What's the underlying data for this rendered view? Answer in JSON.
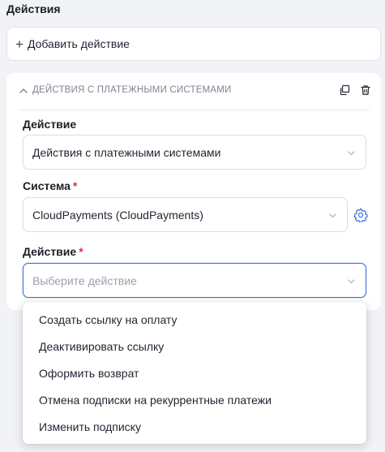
{
  "section": {
    "title": "Действия"
  },
  "add_action": {
    "plus": "+",
    "label": "Добавить действие"
  },
  "panel": {
    "title": "ДЕЙСТВИЯ С ПЛАТЕЖНЫМИ СИСТЕМАМИ",
    "icons": [
      "chevron-up-icon",
      "copy-icon",
      "trash-icon"
    ]
  },
  "fields": {
    "action_type": {
      "label": "Действие",
      "value": "Действия с платежными системами"
    },
    "system": {
      "label": "Система",
      "required_mark": "*",
      "value": "CloudPayments (CloudPayments)"
    },
    "action": {
      "label": "Действие",
      "required_mark": "*",
      "placeholder": "Выберите действие"
    }
  },
  "dropdown": {
    "options": [
      "Создать ссылку на оплату",
      "Деактивировать ссылку",
      "Оформить возврат",
      "Отмена подписки на рекуррентные платежи",
      "Изменить подписку"
    ]
  },
  "colors": {
    "accent": "#3d6fd8",
    "required": "#e0303c",
    "background": "#f2f3f6",
    "muted_text": "#7d8494"
  }
}
